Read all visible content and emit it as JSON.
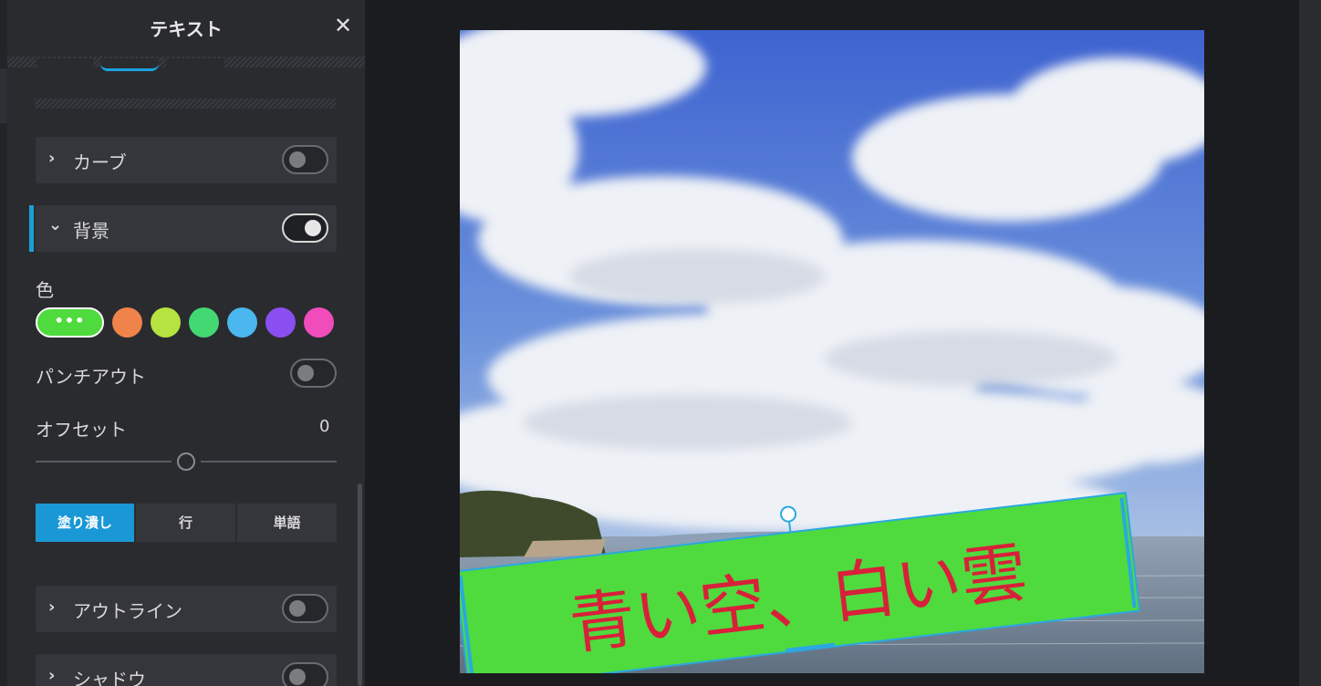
{
  "panel": {
    "title": "テキスト",
    "close_icon": "close-icon",
    "sections": {
      "curve": {
        "label": "カーブ",
        "toggle_on": false
      },
      "background": {
        "label": "背景",
        "toggle_on": true
      },
      "outline": {
        "label": "アウトライン",
        "toggle_on": false
      },
      "shadow": {
        "label": "シャドウ",
        "toggle_on": false
      }
    },
    "color": {
      "label": "色",
      "custom_label": "•••",
      "selected_color": "#4fda3e",
      "swatches": [
        "#f0834a",
        "#b6e33f",
        "#43d872",
        "#4ab7ee",
        "#8a4ff0",
        "#f04cbc"
      ]
    },
    "punchout": {
      "label": "パンチアウト",
      "toggle_on": false
    },
    "offset": {
      "label": "オフセット",
      "value": "0",
      "slider_fraction": 0.5
    },
    "fill_modes": {
      "options": [
        "塗り潰し",
        "行",
        "単語"
      ],
      "selected": "塗り潰し"
    }
  },
  "canvas": {
    "overlay_text": "青い空、白い雲",
    "overlay_bg_color": "#4fda3e",
    "overlay_text_color": "#d8203a",
    "selection_color": "#2aa8e0"
  }
}
